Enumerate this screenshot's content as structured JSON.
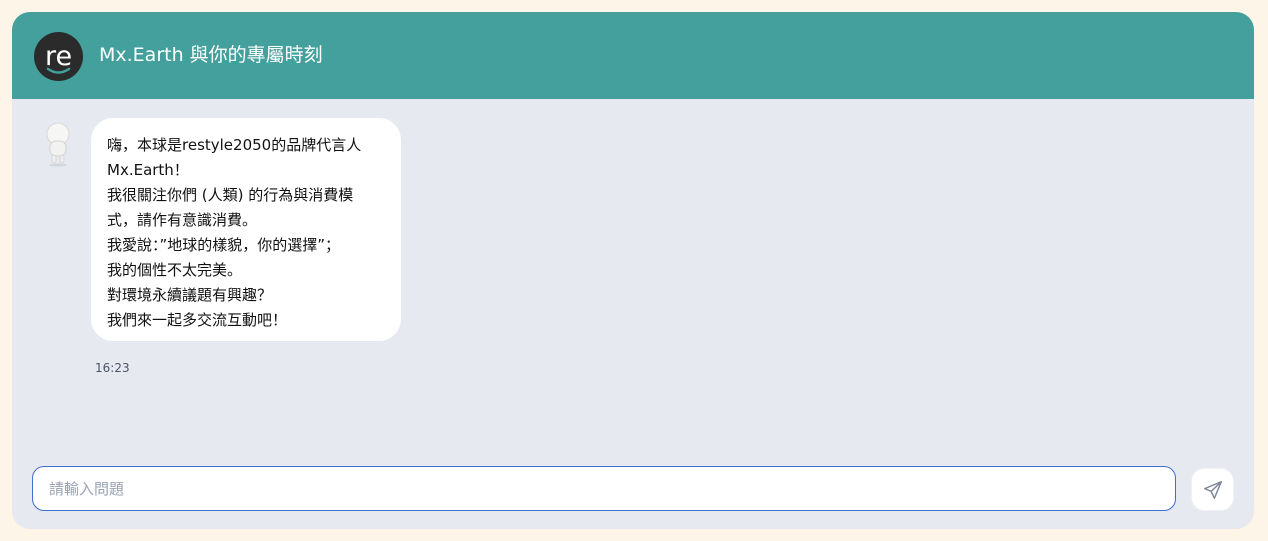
{
  "header": {
    "logo_icon": "restyle-logo-icon",
    "title": "Mx.Earth 與你的專屬時刻"
  },
  "message": {
    "avatar_icon": "mx-earth-avatar",
    "lines": [
      "嗨，本球是restyle2050的品牌代言人",
      "Mx.Earth！",
      "我很關注你們 (人類) 的行為與消費模",
      "式，請作有意識消費。",
      "我愛說：”地球的樣貌，你的選擇”；",
      "我的個性不太完美。",
      "對環境永續議題有興趣？",
      "我們來一起多交流互動吧！"
    ],
    "time": "16:23"
  },
  "composer": {
    "placeholder": "請輸入問題",
    "value": "",
    "send_icon": "send-icon"
  },
  "colors": {
    "header": "#43a09c",
    "page_background": "#fdf5e8",
    "chat_background": "#e6e9f0",
    "input_border": "#3f6fd1"
  }
}
